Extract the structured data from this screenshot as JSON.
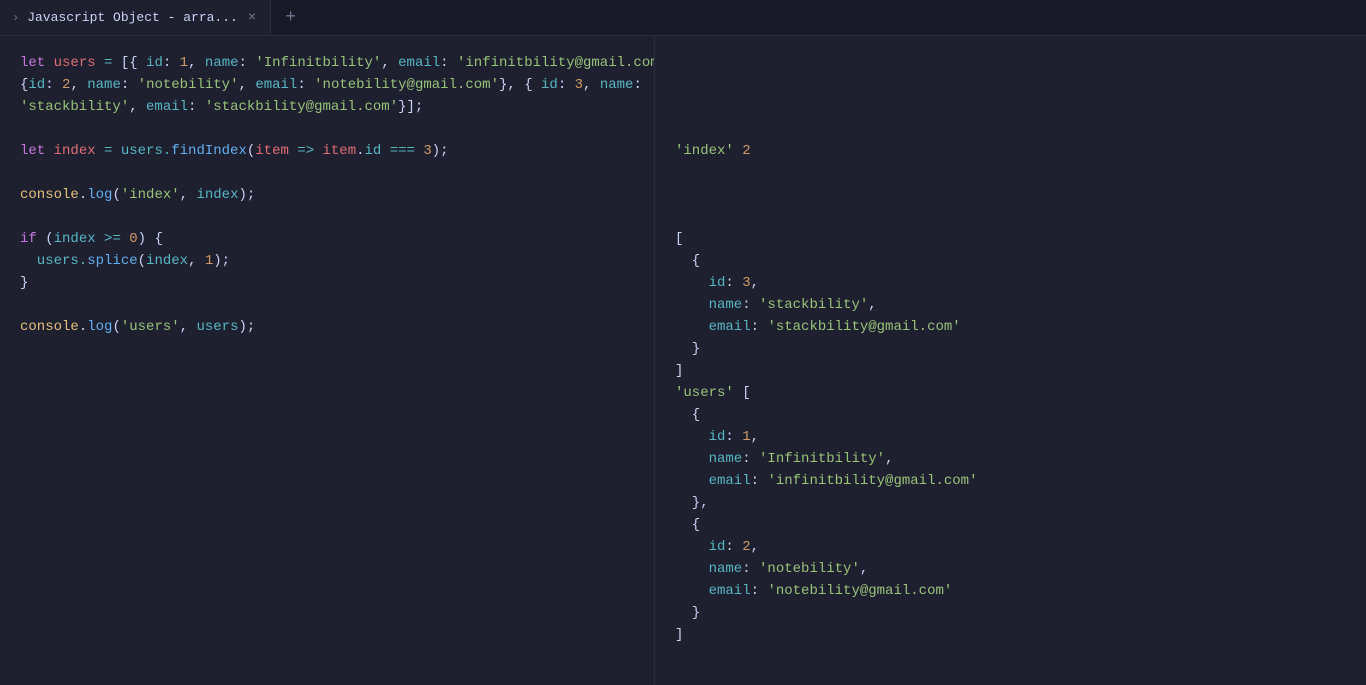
{
  "tab": {
    "title": "Javascript Object - arra..."
  },
  "code": {
    "l1a": "let",
    "l1b": " users ",
    "l1c": "=",
    "l1d": " [{ ",
    "l1e": "id",
    "l1f": ": ",
    "l1g": "1",
    "l1h": ", ",
    "l1i": "name",
    "l1j": ": ",
    "l1k": "'Infinitbility'",
    "l1l": ", ",
    "l1m": "email",
    "l1n": ": ",
    "l1o": "'infinitbility@gmail.com'",
    "l1p": "},",
    "l2a": "{",
    "l2b": "id",
    "l2c": ": ",
    "l2d": "2",
    "l2e": ", ",
    "l2f": "name",
    "l2g": ": ",
    "l2h": "'notebility'",
    "l2i": ", ",
    "l2j": "email",
    "l2k": ": ",
    "l2l": "'notebility@gmail.com'",
    "l2m": "}, { ",
    "l2n": "id",
    "l2o": ": ",
    "l2p": "3",
    "l2q": ", ",
    "l2r": "name",
    "l2s": ":",
    "l3a": "'stackbility'",
    "l3b": ", ",
    "l3c": "email",
    "l3d": ": ",
    "l3e": "'stackbility@gmail.com'",
    "l3f": "}];",
    "l5a": "let",
    "l5b": " index ",
    "l5c": "=",
    "l5d": " users.",
    "l5e": "findIndex",
    "l5f": "(",
    "l5g": "item",
    "l5h": " => ",
    "l5i": "item",
    "l5j": ".",
    "l5k": "id",
    "l5l": " === ",
    "l5m": "3",
    "l5n": ");",
    "l7a": "console",
    "l7b": ".",
    "l7c": "log",
    "l7d": "(",
    "l7e": "'index'",
    "l7f": ", ",
    "l7g": "index",
    "l7h": ");",
    "l9a": "if",
    "l9b": " (",
    "l9c": "index",
    "l9d": " >= ",
    "l9e": "0",
    "l9f": ") {",
    "l10a": "  users.",
    "l10b": "splice",
    "l10c": "(",
    "l10d": "index",
    "l10e": ", ",
    "l10f": "1",
    "l10g": ");",
    "l11a": "}",
    "l13a": "console",
    "l13b": ".",
    "l13c": "log",
    "l13d": "(",
    "l13e": "'users'",
    "l13f": ", ",
    "l13g": "users",
    "l13h": ");"
  },
  "output": {
    "r1a": "'index'",
    "r1b": " 2",
    "r5": "[",
    "r6": "  {",
    "r7a": "    id",
    "r7b": ": ",
    "r7c": "3",
    "r7d": ",",
    "r8a": "    name",
    "r8b": ": ",
    "r8c": "'stackbility'",
    "r8d": ",",
    "r9a": "    email",
    "r9b": ": ",
    "r9c": "'stackbility@gmail.com'",
    "r10": "  }",
    "r11": "]",
    "r12a": "'users'",
    "r12b": " [",
    "r13": "  {",
    "r14a": "    id",
    "r14b": ": ",
    "r14c": "1",
    "r14d": ",",
    "r15a": "    name",
    "r15b": ": ",
    "r15c": "'Infinitbility'",
    "r15d": ",",
    "r16a": "    email",
    "r16b": ": ",
    "r16c": "'infinitbility@gmail.com'",
    "r17": "  },",
    "r18": "  {",
    "r19a": "    id",
    "r19b": ": ",
    "r19c": "2",
    "r19d": ",",
    "r20a": "    name",
    "r20b": ": ",
    "r20c": "'notebility'",
    "r20d": ",",
    "r21a": "    email",
    "r21b": ": ",
    "r21c": "'notebility@gmail.com'",
    "r22": "  }",
    "r23": "]"
  }
}
